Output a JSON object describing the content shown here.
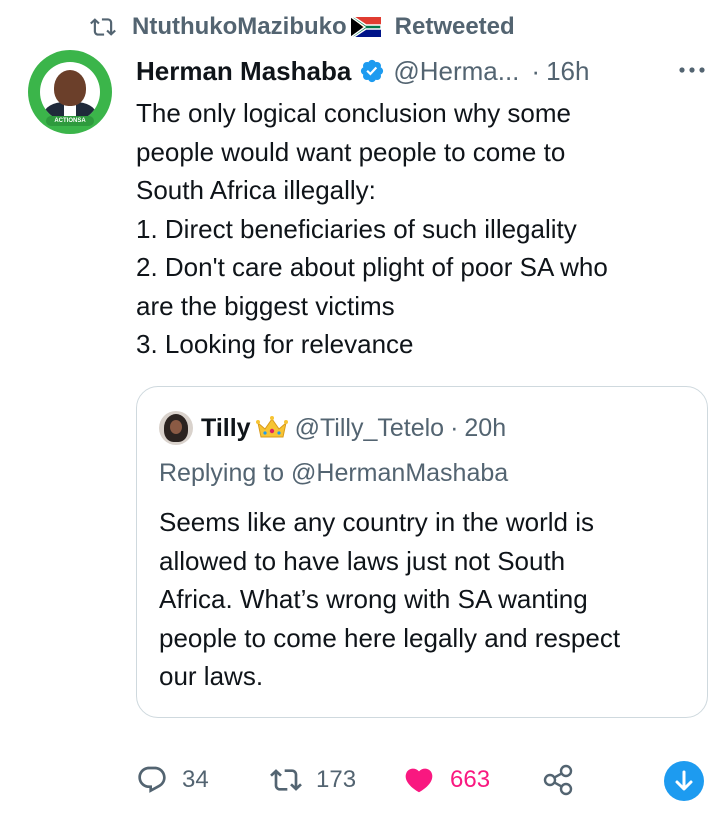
{
  "retweet": {
    "user": "NtuthukoMazibuko",
    "label": "Retweeted",
    "icon": "retweet-icon",
    "flag": "south-africa-flag-emoji"
  },
  "tweet": {
    "author_name": "Herman Mashaba",
    "author_handle": "@Herma...",
    "separator": "·",
    "time": "16h",
    "verified": true,
    "body_lines": [
      "The only logical conclusion why some",
      "people would want people to come to",
      "South Africa illegally:",
      "1. Direct beneficiaries of such illegality",
      "2. Don't care about plight of poor SA who",
      "are the biggest victims",
      "3. Looking for relevance"
    ]
  },
  "quote": {
    "author_name": "Tilly",
    "author_handle": "@Tilly_Tetelo",
    "separator": "·",
    "time": "20h",
    "replying_to": "Replying to @HermanMashaba",
    "body_lines": [
      "Seems like any country in the world is",
      "allowed to have laws just not South",
      "Africa. What’s wrong with SA wanting",
      "people to come here legally and respect",
      "our laws."
    ]
  },
  "actions": {
    "replies": "34",
    "retweets": "173",
    "likes": "663",
    "liked": true
  },
  "colors": {
    "text": "#0f1419",
    "secondary": "#536471",
    "like": "#f91880",
    "accent": "#1d9bf0",
    "border": "#cfd9de"
  }
}
